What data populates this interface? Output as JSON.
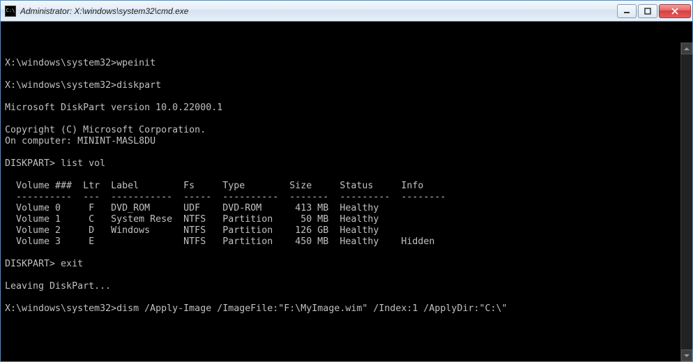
{
  "window": {
    "title": "Administrator: X:\\windows\\system32\\cmd.exe",
    "icon_label": "C:\\"
  },
  "terminal": {
    "lines": [
      "",
      "X:\\windows\\system32>wpeinit",
      "",
      "X:\\windows\\system32>diskpart",
      "",
      "Microsoft DiskPart version 10.0.22000.1",
      "",
      "Copyright (C) Microsoft Corporation.",
      "On computer: MININT-MASL8DU",
      "",
      "DISKPART> list vol",
      "",
      "  Volume ###  Ltr  Label        Fs     Type        Size     Status     Info",
      "  ----------  ---  -----------  -----  ----------  -------  ---------  --------",
      "  Volume 0     F   DVD_ROM      UDF    DVD-ROM      413 MB  Healthy",
      "  Volume 1     C   System Rese  NTFS   Partition     50 MB  Healthy",
      "  Volume 2     D   Windows      NTFS   Partition    126 GB  Healthy",
      "  Volume 3     E                NTFS   Partition    450 MB  Healthy    Hidden",
      "",
      "DISKPART> exit",
      "",
      "Leaving DiskPart...",
      "",
      "X:\\windows\\system32>dism /Apply-Image /ImageFile:\"F:\\MyImage.wim\" /Index:1 /ApplyDir:\"C:\\\""
    ]
  },
  "buttons": {
    "minimize": "Minimize",
    "maximize": "Maximize",
    "close": "Close"
  }
}
